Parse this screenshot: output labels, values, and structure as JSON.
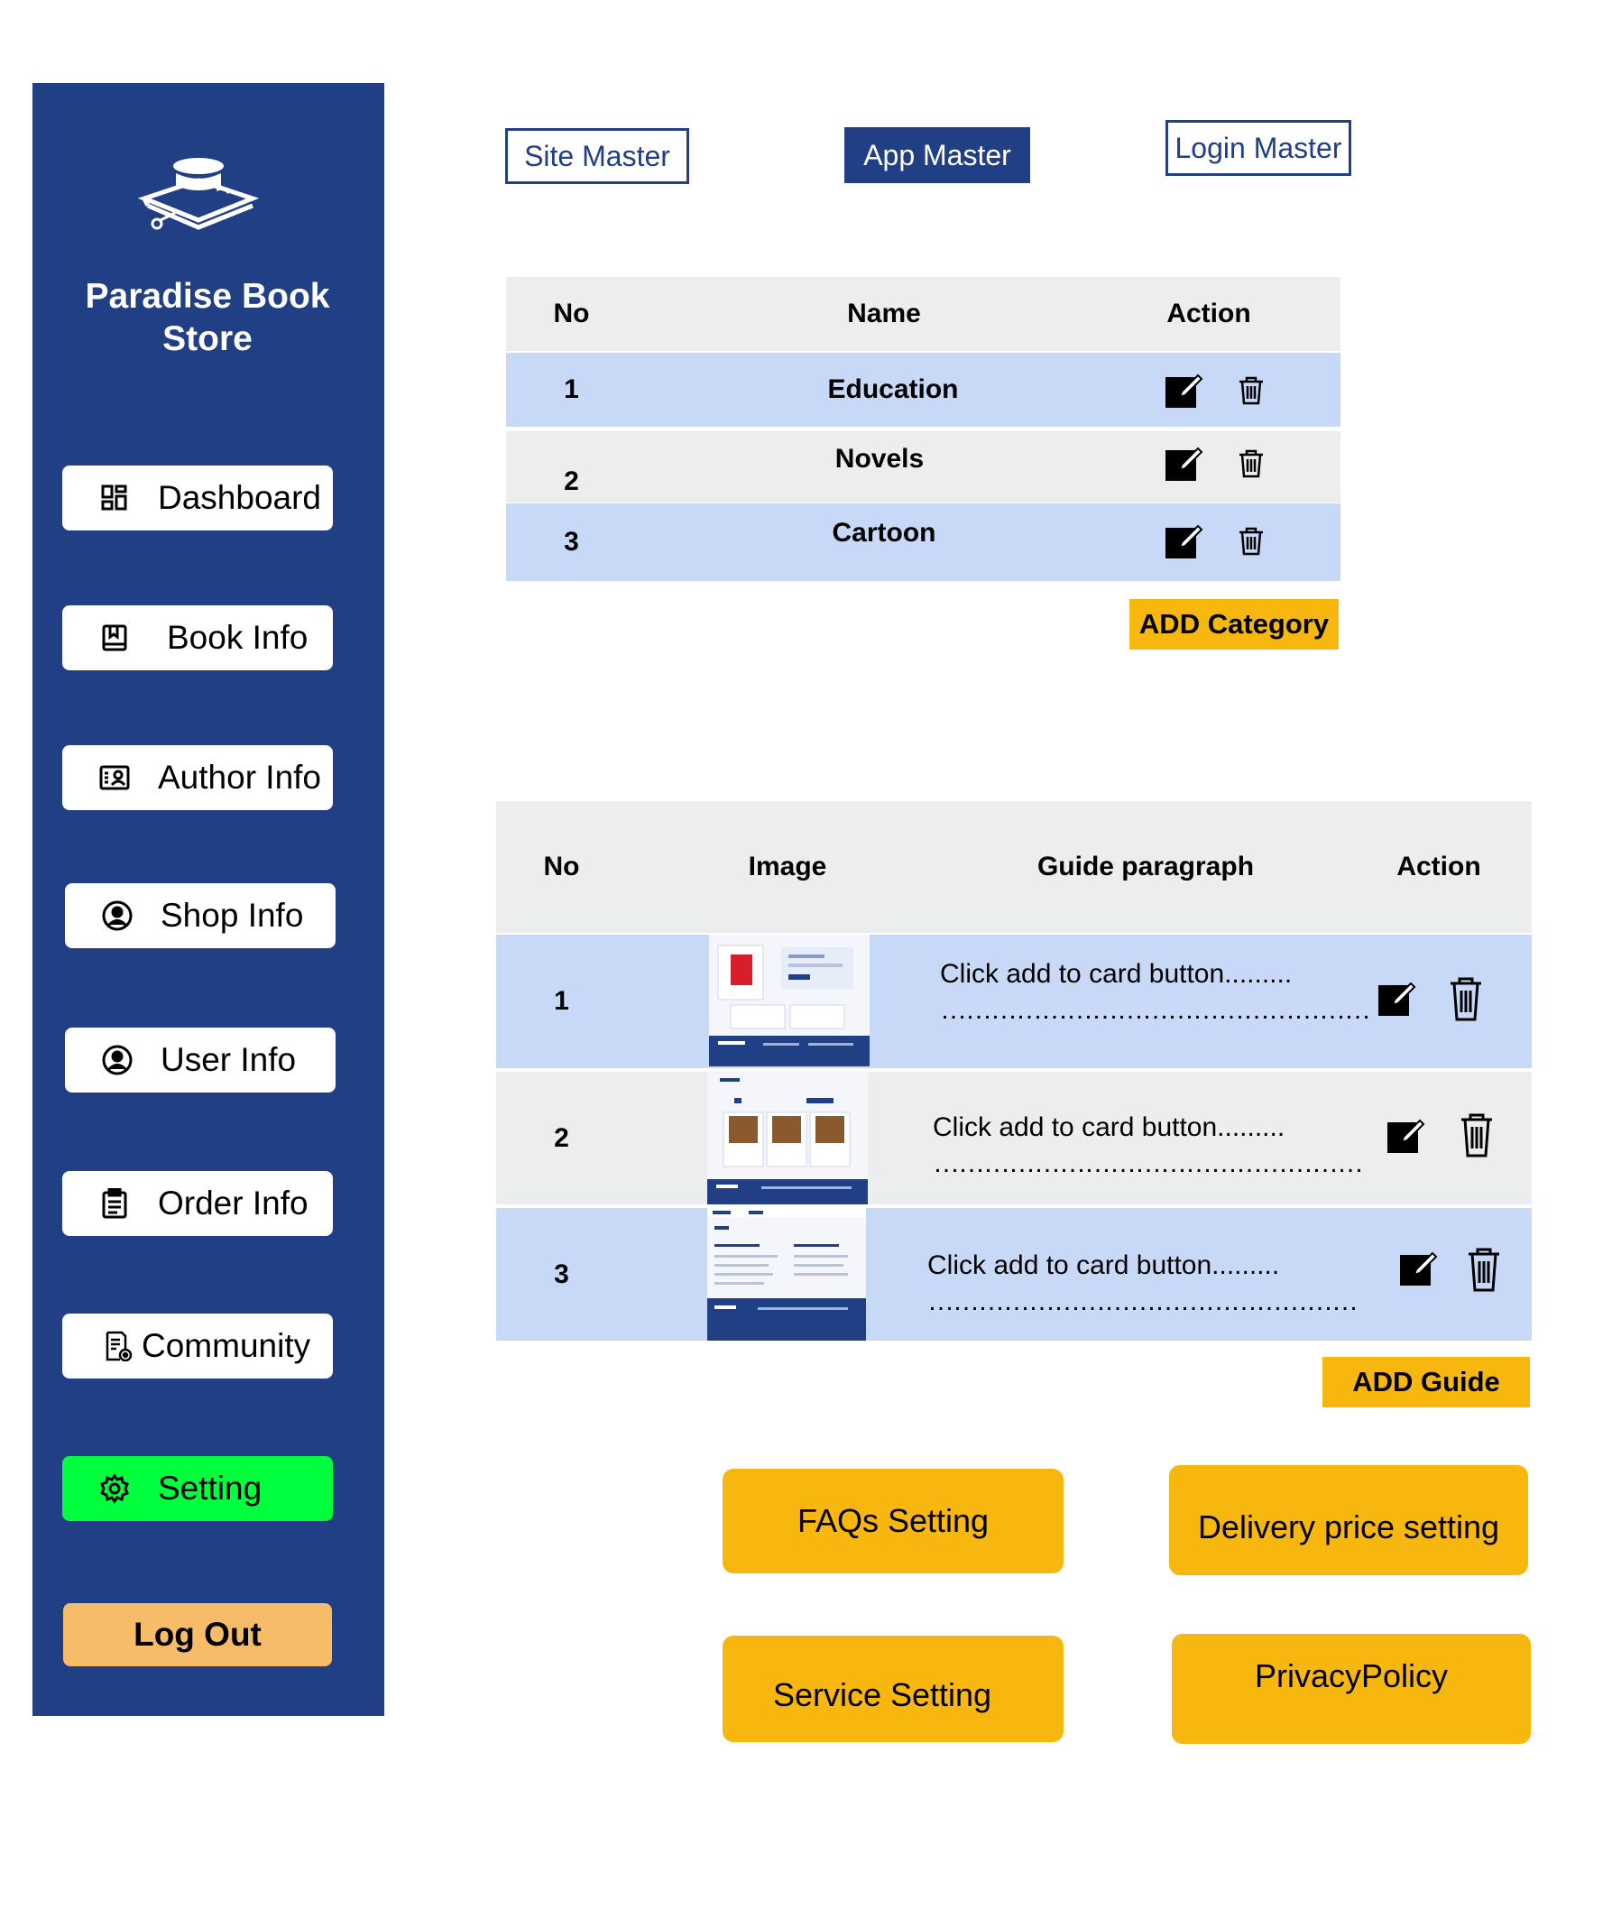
{
  "sidebar": {
    "brand": "Paradise Book Store",
    "logo_icon": "book-store-logo-icon",
    "items": [
      {
        "label": "Dashboard",
        "icon": "dashboard-icon"
      },
      {
        "label": "Book Info",
        "icon": "book-icon"
      },
      {
        "label": "Author Info",
        "icon": "author-card-icon"
      },
      {
        "label": "Shop Info",
        "icon": "user-circle-icon"
      },
      {
        "label": "User Info",
        "icon": "user-circle-icon"
      },
      {
        "label": "Order Info",
        "icon": "clipboard-icon"
      },
      {
        "label": "Community",
        "icon": "community-doc-icon"
      },
      {
        "label": "Setting",
        "icon": "gear-icon",
        "active": true
      }
    ],
    "logout": "Log Out"
  },
  "tabs": [
    {
      "label": "Site Master"
    },
    {
      "label": "App Master",
      "active": true
    },
    {
      "label": "Login Master"
    }
  ],
  "category_table": {
    "headers": [
      "No",
      "Name",
      "Action"
    ],
    "rows": [
      {
        "no": "1",
        "name": "Education"
      },
      {
        "no": "2",
        "name": "Novels"
      },
      {
        "no": "3",
        "name": "Cartoon"
      }
    ],
    "add_button": "ADD Category"
  },
  "guide_table": {
    "headers": [
      "No",
      "Image",
      "Guide paragraph",
      "Action"
    ],
    "rows": [
      {
        "no": "1",
        "text": "Click add to card button.........",
        "dots": "……………………………………………"
      },
      {
        "no": "2",
        "text": "Click add to card button.........",
        "dots": "……………………………………………"
      },
      {
        "no": "3",
        "text": "Click add to card button.........",
        "dots": "……………………………………………"
      }
    ],
    "add_button": "ADD Guide"
  },
  "settings_buttons": {
    "faqs": "FAQs Setting",
    "delivery": "Delivery price setting",
    "service": "Service Setting",
    "privacy": "PrivacyPolicy"
  },
  "colors": {
    "sidebar_bg": "#203f84",
    "active_nav": "#00ff3d",
    "logout_bg": "#f7bc69",
    "accent_yellow": "#f7b70f",
    "row_blue": "#c8d9f8",
    "row_grey": "#eceded"
  }
}
